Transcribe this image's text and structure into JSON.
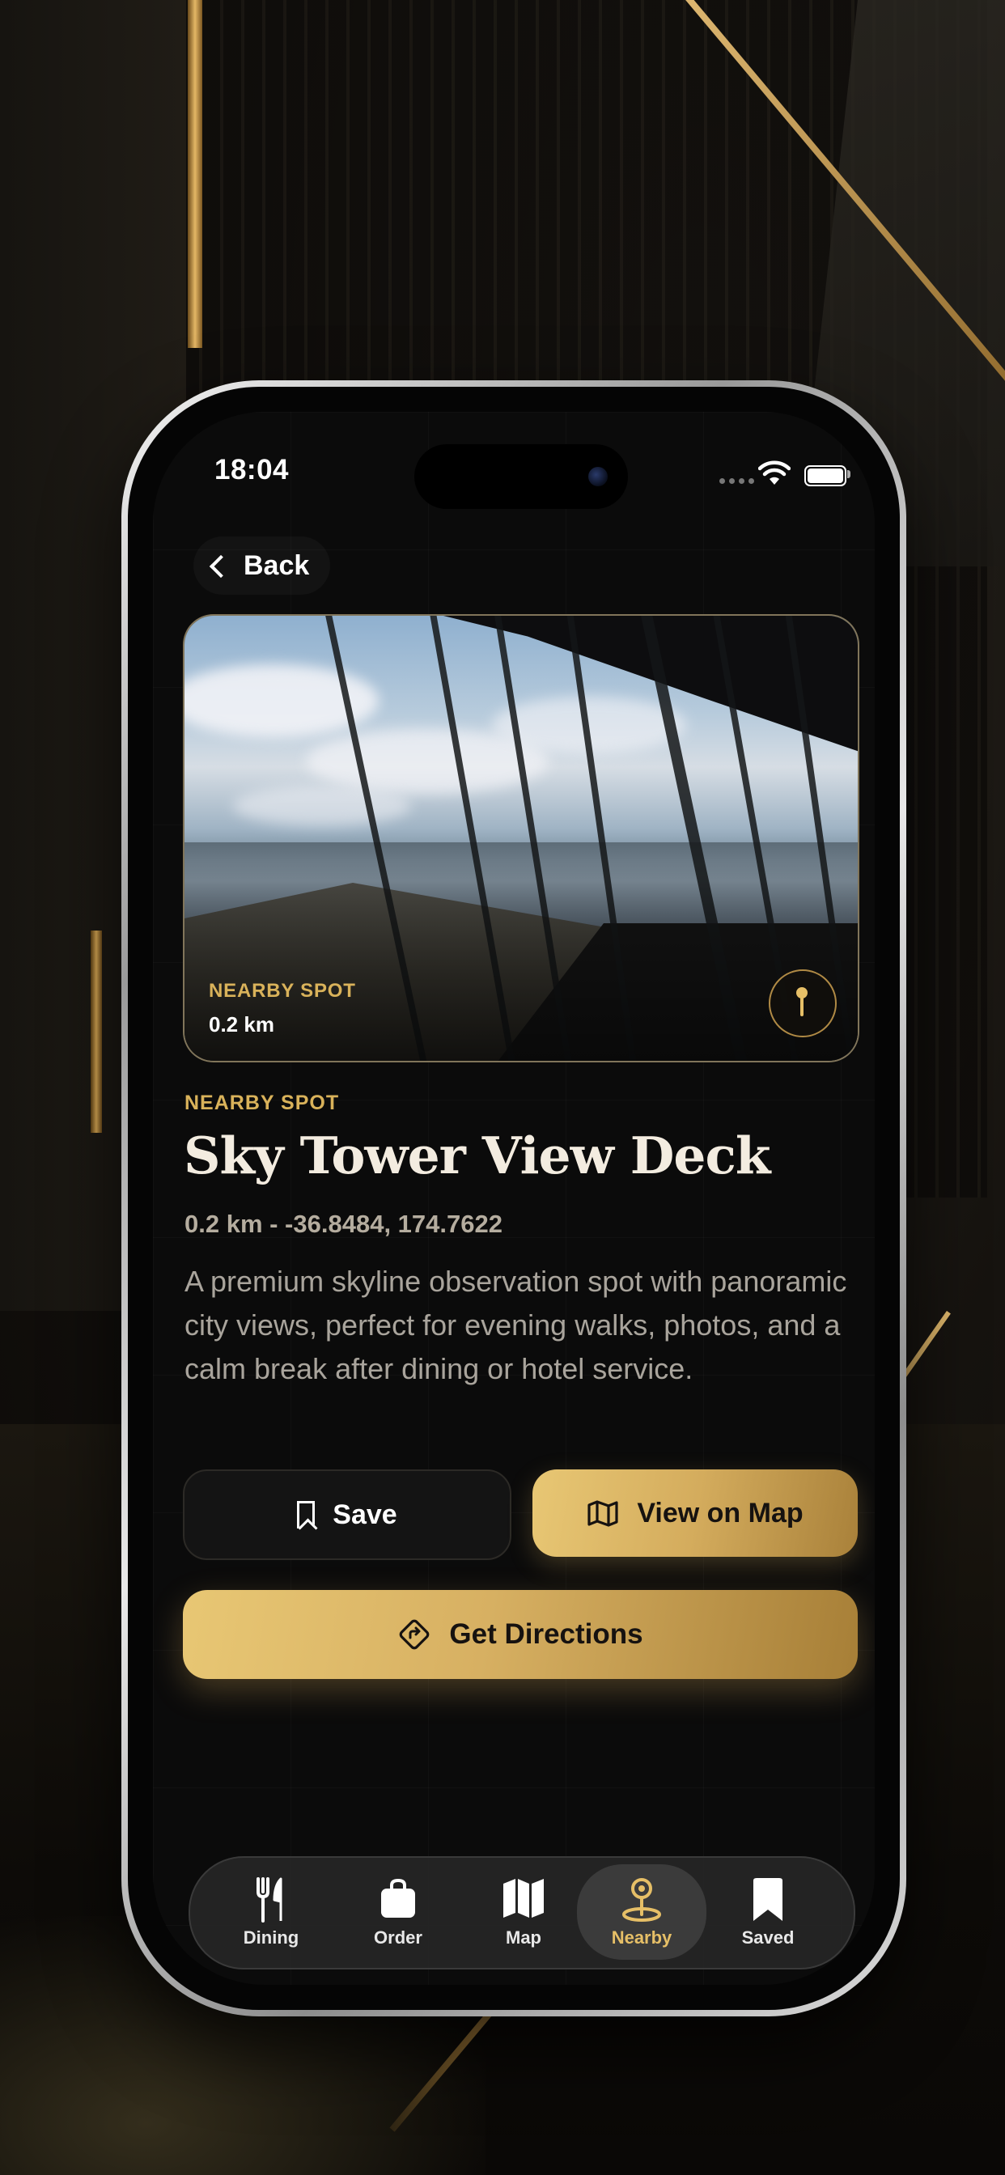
{
  "status_bar": {
    "time": "18:04"
  },
  "nav": {
    "back_label": "Back"
  },
  "hero": {
    "tag": "NEARBY SPOT",
    "distance": "0.2 km"
  },
  "detail": {
    "eyebrow": "NEARBY SPOT",
    "title": "Sky Tower View Deck",
    "meta": "0.2 km - -36.8484, 174.7622",
    "description": "A premium skyline observation spot with panoramic city views, perfect for evening walks, photos, and a calm break after dining or hotel service."
  },
  "actions": {
    "save_label": "Save",
    "view_map_label": "View on Map",
    "directions_label": "Get Directions"
  },
  "tabs": [
    {
      "label": "Dining",
      "icon": "fork-knife-icon",
      "active": false
    },
    {
      "label": "Order",
      "icon": "bag-icon",
      "active": false
    },
    {
      "label": "Map",
      "icon": "map-icon",
      "active": false
    },
    {
      "label": "Nearby",
      "icon": "location-pin-icon",
      "active": true
    },
    {
      "label": "Saved",
      "icon": "bookmark-icon",
      "active": false
    }
  ],
  "colors": {
    "accent_gold": "#d9b25a",
    "background": "#0b0b0b",
    "text_primary": "#f3ece0"
  }
}
